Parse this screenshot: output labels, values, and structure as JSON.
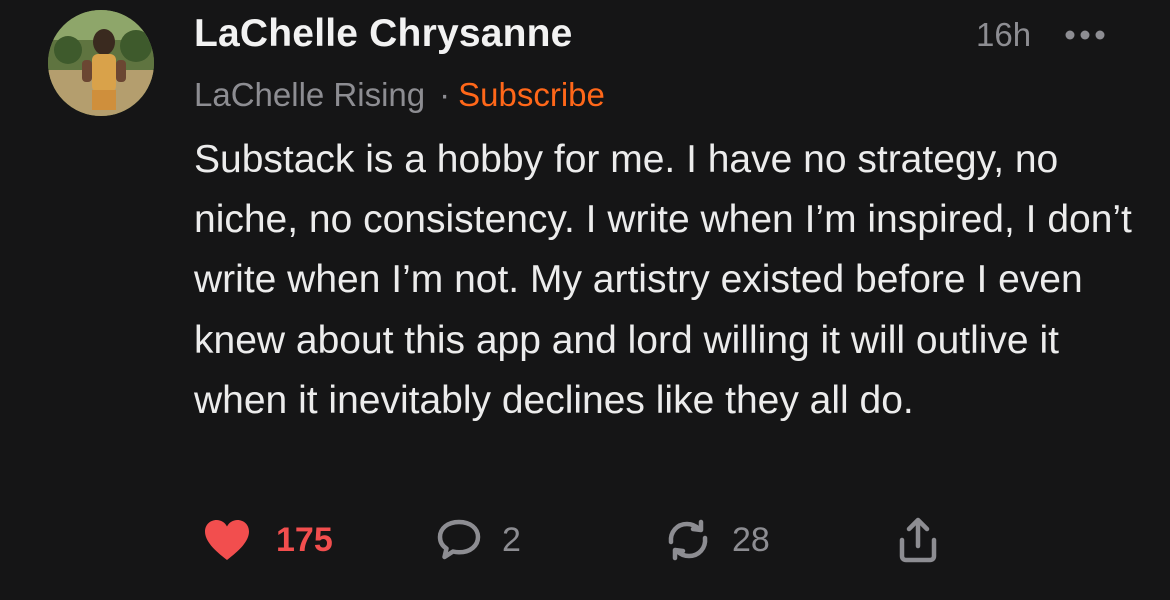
{
  "note": {
    "author": "LaChelle Chrysanne",
    "timestamp": "16h",
    "publication": "LaChelle Rising",
    "separator": "·",
    "subscribe_label": "Subscribe",
    "body": "Substack is a hobby for me. I have no strategy, no niche, no consistency. I write when I’m inspired, I don’t write when I’m not. My artistry existed before I even knew about this app and lord willing it will outlive it when it inevitably declines like they all do.",
    "actions": {
      "likes": "175",
      "comments": "2",
      "restacks": "28"
    },
    "icons": {
      "more": "more-horizontal-icon",
      "like": "heart-icon",
      "comment": "comment-icon",
      "restack": "restack-icon",
      "share": "share-icon"
    },
    "colors": {
      "background": "#151516",
      "accent": "#ff6719",
      "like": "#f24e4e",
      "muted": "#8d8d92",
      "text": "#ececec"
    }
  }
}
